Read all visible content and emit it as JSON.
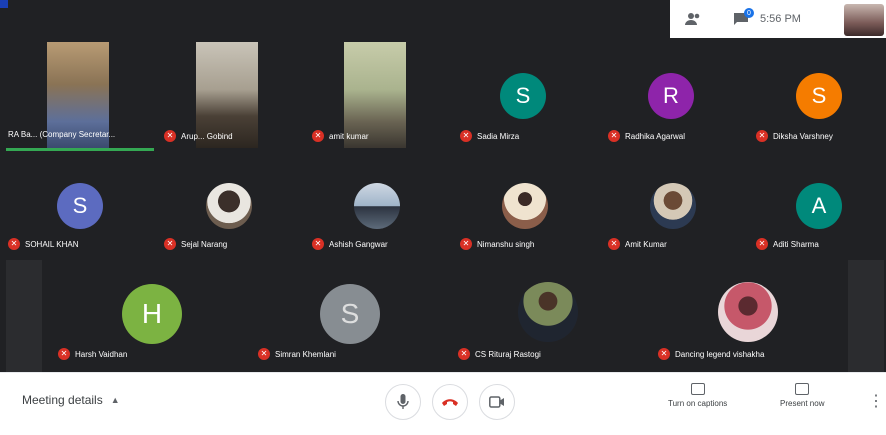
{
  "topbar": {
    "clock": "5:56 PM",
    "chat_badge": "0",
    "icons": [
      "people-icon",
      "chat-icon"
    ]
  },
  "participants": {
    "row1": [
      {
        "name": "RA Ba... (Company Secretar...",
        "type": "video"
      },
      {
        "name": "Arup... Gobind",
        "type": "video"
      },
      {
        "name": "amit kumar",
        "type": "video"
      },
      {
        "name": "Sadia Mirza",
        "initial": "S",
        "color": "#00897b"
      },
      {
        "name": "Radhika Agarwal",
        "initial": "R",
        "color": "#8e24aa"
      },
      {
        "name": "Diksha Varshney",
        "initial": "S",
        "color": "#f57c00"
      }
    ],
    "row2": [
      {
        "name": "SOHAIL KHAN",
        "initial": "S",
        "color": "#5c6bc0"
      },
      {
        "name": "Sejal Narang",
        "type": "photo"
      },
      {
        "name": "Ashish Gangwar",
        "type": "photo"
      },
      {
        "name": "Nimanshu singh",
        "type": "photo"
      },
      {
        "name": "Amit Kumar",
        "type": "photo"
      },
      {
        "name": "Aditi Sharma",
        "initial": "A",
        "color": "#00897b"
      }
    ],
    "row3": [
      {
        "name": "Harsh Vaidhan",
        "initial": "H",
        "color": "#7cb342"
      },
      {
        "name": "Simran Khemlani",
        "initial": "S",
        "color": "#9aa0a6"
      },
      {
        "name": "CS Rituraj Rastogi",
        "type": "photo"
      },
      {
        "name": "Dancing legend vishakha",
        "type": "photo"
      }
    ]
  },
  "bottombar": {
    "meeting_details": "Meeting details",
    "captions_label": "Turn on captions",
    "present_label": "Present now"
  }
}
